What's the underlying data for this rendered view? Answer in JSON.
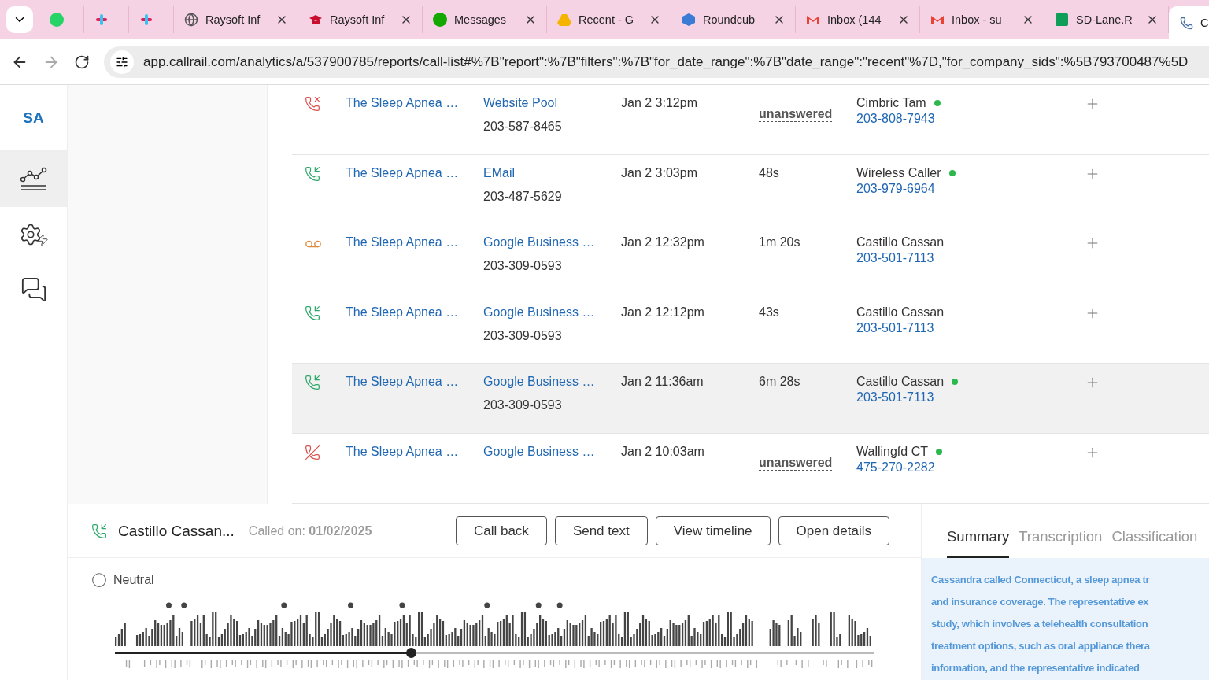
{
  "browser": {
    "tabs": [
      {
        "selected": false
      },
      {
        "selected": false
      },
      {
        "selected": false
      },
      {
        "title": "Raysoft Inf",
        "selected": false
      },
      {
        "title": "Raysoft Inf",
        "selected": false
      },
      {
        "title": "Messages",
        "selected": false
      },
      {
        "title": "Recent - G",
        "selected": false
      },
      {
        "title": "Roundcub",
        "selected": false
      },
      {
        "title": "Inbox (144",
        "selected": false
      },
      {
        "title": "Inbox - su",
        "selected": false
      },
      {
        "title": "SD-Lane.R",
        "selected": false
      },
      {
        "title": "C",
        "selected": true
      }
    ],
    "url": "app.callrail.com/analytics/a/537900785/reports/call-list#%7B\"report\":%7B\"filters\":%7B\"for_date_range\":%7B\"date_range\":\"recent\"%7D,\"for_company_sids\":%5B793700487%5D"
  },
  "sidebar": {
    "account": "SA",
    "items": [
      {
        "selected": true
      },
      {
        "selected": false
      },
      {
        "selected": false
      }
    ]
  },
  "calls": [
    {
      "kind": "missed",
      "source": "The Sleep Apnea …",
      "tracking": "Website Pool",
      "tracking_number": "203-587-8465",
      "date": "Jan 2 3:12pm",
      "duration": "unanswered",
      "answered": false,
      "caller": "Cimbric Tam",
      "caller_number": "203-808-7943",
      "dot": true,
      "selected": false
    },
    {
      "kind": "incoming",
      "source": "The Sleep Apnea …",
      "tracking": "EMail",
      "tracking_number": "203-487-5629",
      "date": "Jan 2 3:03pm",
      "duration": "48s",
      "answered": true,
      "caller": "Wireless Caller",
      "caller_number": "203-979-6964",
      "dot": true,
      "selected": false
    },
    {
      "kind": "voicemail",
      "source": "The Sleep Apnea …",
      "tracking": "Google Business …",
      "tracking_number": "203-309-0593",
      "date": "Jan 2 12:32pm",
      "duration": "1m 20s",
      "answered": true,
      "caller": "Castillo Cassan",
      "caller_number": "203-501-7113",
      "dot": false,
      "selected": false
    },
    {
      "kind": "incoming",
      "source": "The Sleep Apnea …",
      "tracking": "Google Business …",
      "tracking_number": "203-309-0593",
      "date": "Jan 2 12:12pm",
      "duration": "43s",
      "answered": true,
      "caller": "Castillo Cassan",
      "caller_number": "203-501-7113",
      "dot": false,
      "selected": false
    },
    {
      "kind": "incoming",
      "source": "The Sleep Apnea …",
      "tracking": "Google Business …",
      "tracking_number": "203-309-0593",
      "date": "Jan 2 11:36am",
      "duration": "6m 28s",
      "answered": true,
      "caller": "Castillo Cassan",
      "caller_number": "203-501-7113",
      "dot": true,
      "selected": true
    },
    {
      "kind": "declined",
      "source": "The Sleep Apnea …",
      "tracking": "Google Business …",
      "date": "Jan 2 10:03am",
      "duration": "unanswered",
      "answered": false,
      "caller": "Wallingfd CT",
      "caller_number": "475-270-2282",
      "dot": true,
      "selected": false
    }
  ],
  "detail": {
    "caller": "Castillo Cassan...",
    "called_on_label": "Called on:",
    "called_on": "01/02/2025",
    "buttons": [
      "Call back",
      "Send text",
      "View timeline",
      "Open details"
    ],
    "sentiment": "Neutral",
    "playback": {
      "level": 0.39
    },
    "tabs": [
      {
        "label": "Summary",
        "selected": true
      },
      {
        "label": "Transcription",
        "selected": false
      },
      {
        "label": "Classification",
        "selected": false
      }
    ],
    "summary_lines": [
      "Cassandra called Connecticut, a sleep apnea tr",
      "and insurance coverage. The representative ex",
      "study, which involves a telehealth consultation",
      "treatment options, such as oral appliance thera",
      "information, and the representative indicated"
    ]
  }
}
